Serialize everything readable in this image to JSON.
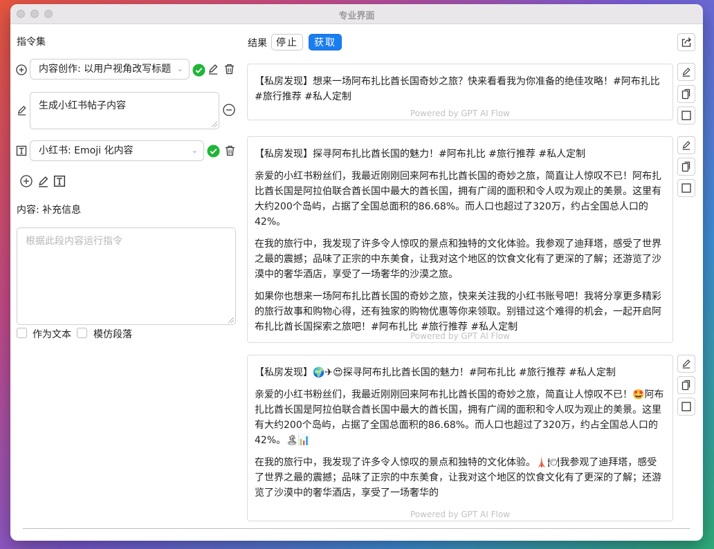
{
  "window": {
    "title": "专业界面"
  },
  "left": {
    "heading": "指令集",
    "instruction_1": {
      "select_value": "内容创作: 以用户视角改写标题"
    },
    "instruction_2": {
      "textarea_value": "生成小红书帖子内容"
    },
    "instruction_3": {
      "select_value": "小红书: Emoji 化内容"
    },
    "content_label": "内容: 补充信息",
    "content_placeholder": "根据此段内容运行指令",
    "checkbox_as_text": "作为文本",
    "checkbox_imitate": "模仿段落"
  },
  "right": {
    "result_label": "结果",
    "stop_label": "停止",
    "fetch_label": "获取",
    "powered_by": "Powered by GPT AI Flow",
    "cards": [
      {
        "paragraphs": [
          "【私房发现】想来一场阿布扎比酋长国奇妙之旅？快来看看我为你准备的绝佳攻略！#阿布扎比 #旅行推荐 #私人定制"
        ]
      },
      {
        "paragraphs": [
          "【私房发现】探寻阿布扎比酋长国的魅力！#阿布扎比 #旅行推荐 #私人定制",
          "亲爱的小红书粉丝们，我最近刚刚回来阿布扎比酋长国的奇妙之旅，简直让人惊叹不已！阿布扎比酋长国是阿拉伯联合酋长国中最大的酋长国，拥有广阔的面积和令人叹为观止的美景。这里有大约200个岛屿，占据了全国总面积的86.68%。而人口也超过了320万，约占全国总人口的42%。",
          "在我的旅行中，我发现了许多令人惊叹的景点和独特的文化体验。我参观了迪拜塔，感受了世界之最的震撼；品味了正宗的中东美食，让我对这个地区的饮食文化有了更深的了解；还游览了沙漠中的奢华酒店，享受了一场奢华的沙漠之旅。",
          "如果你也想来一场阿布扎比酋长国的奇妙之旅，快来关注我的小红书账号吧！我将分享更多精彩的旅行故事和购物心得，还有独家的购物优惠等你来领取。别错过这个难得的机会，一起开启阿布扎比酋长国探索之旅吧！#阿布扎比 #旅行推荐 #私人定制"
        ]
      },
      {
        "paragraphs": [
          "【私房发现】🌍✈😍探寻阿布扎比酋长国的魅力！#阿布扎比 #旅行推荐 #私人定制",
          "亲爱的小红书粉丝们，我最近刚刚回来阿布扎比酋长国的奇妙之旅，简直让人惊叹不已！🤩阿布扎比酋长国是阿拉伯联合酋长国中最大的酋长国，拥有广阔的面积和令人叹为观止的美景。这里有大约200个岛屿，占据了全国总面积的86.68%。而人口也超过了320万，约占全国总人口的42%。🏝📊",
          "在我的旅行中，我发现了许多令人惊叹的景点和独特的文化体验。🗼🍽我参观了迪拜塔，感受了世界之最的震撼；品味了正宗的中东美食，让我对这个地区的饮食文化有了更深的了解；还游览了沙漠中的奢华酒店，享受了一场奢华的"
        ]
      }
    ]
  }
}
